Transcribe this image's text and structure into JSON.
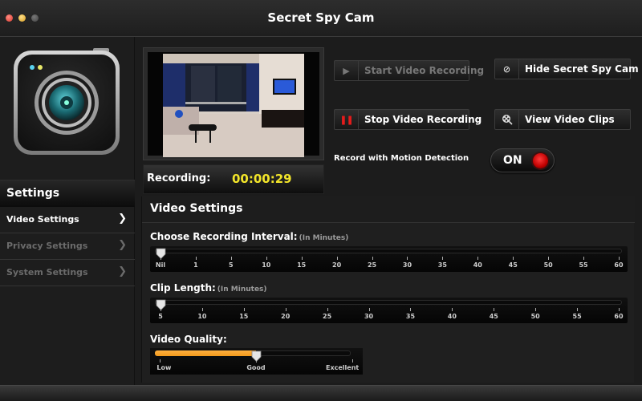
{
  "window": {
    "title": "Secret Spy Cam",
    "controls": [
      "close",
      "minimize",
      "zoom"
    ]
  },
  "sidebar": {
    "app_icon": "camera-app-icon",
    "header": "Settings",
    "items": [
      {
        "label": "Video Settings",
        "active": true
      },
      {
        "label": "Privacy Settings",
        "active": false
      },
      {
        "label": "System Settings",
        "active": false
      }
    ]
  },
  "preview": {
    "image": "living-room-camera-feed",
    "recording_label": "Recording:",
    "recording_time": "00:00:29"
  },
  "actions": {
    "start": {
      "label": "Start Video Recording",
      "icon": "play-icon",
      "enabled": false
    },
    "stop": {
      "label": "Stop Video  Recording",
      "icon": "pause-icon",
      "enabled": true
    },
    "hide": {
      "label": "Hide Secret Spy Cam",
      "icon": "prohibited-icon",
      "enabled": true
    },
    "clips": {
      "label": "View Video Clips",
      "icon": "film-reel-search-icon",
      "enabled": true
    }
  },
  "motion_detection": {
    "label": "Record with Motion Detection",
    "state": "ON"
  },
  "video_settings": {
    "header": "Video Settings",
    "recording_interval": {
      "label": "Choose Recording Interval:",
      "unit": "(In Minutes)",
      "ticks": [
        "Nil",
        "1",
        "5",
        "10",
        "15",
        "20",
        "25",
        "30",
        "35",
        "40",
        "45",
        "50",
        "55",
        "60"
      ],
      "selected_index": 0
    },
    "clip_length": {
      "label": "Clip Length:",
      "unit": "(In Minutes)",
      "ticks": [
        "5",
        "10",
        "15",
        "20",
        "25",
        "30",
        "35",
        "40",
        "45",
        "50",
        "55",
        "60"
      ],
      "selected_index": 0
    },
    "video_quality": {
      "label": "Video Quality:",
      "ticks": [
        "Low",
        "Good",
        "Excellent"
      ],
      "selected": "Good",
      "fraction": 0.5
    }
  },
  "colors": {
    "timer": "#f2e52a",
    "quality_fill": "#f39a1c",
    "record_led": "#ff2a2a",
    "pause_icon": "#e41b1b"
  }
}
